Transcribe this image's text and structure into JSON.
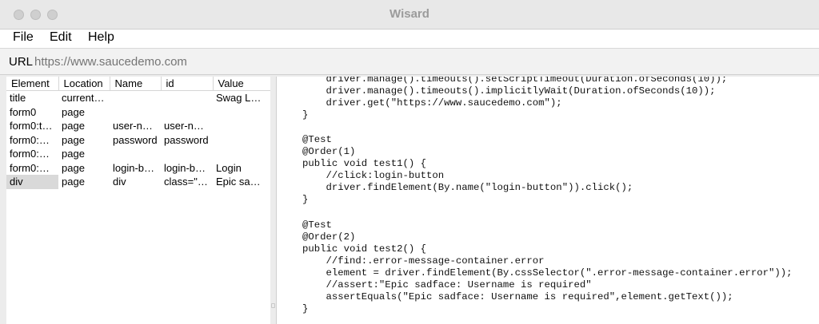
{
  "window": {
    "title": "Wisard"
  },
  "menu": [
    "File",
    "Edit",
    "Help"
  ],
  "url": {
    "label": "URL",
    "value": "",
    "placeholder": "https://www.saucedemo.com"
  },
  "elements_table": {
    "columns": [
      "Element",
      "Location",
      "Name",
      "id",
      "Value"
    ],
    "rows": [
      [
        "title",
        "current…",
        "",
        "",
        "Swag L…"
      ],
      [
        "form0",
        "page",
        "",
        "",
        ""
      ],
      [
        "form0:t…",
        "page",
        "user-n…",
        "user-n…",
        ""
      ],
      [
        "form0:…",
        "page",
        "password",
        "password",
        ""
      ],
      [
        "form0:…",
        "page",
        "",
        "",
        ""
      ],
      [
        "form0:…",
        "page",
        "login-b…",
        "login-b…",
        "Login"
      ],
      [
        "div",
        "page",
        "div",
        "class=\"…",
        "Epic sa…"
      ]
    ]
  },
  "code_lines": [
    "    driver.manage().timeouts().setScriptTimeout(Duration.ofSeconds(10));",
    "    driver.manage().timeouts().implicitlyWait(Duration.ofSeconds(10));",
    "    driver.get(\"https://www.saucedemo.com\");",
    "}",
    "",
    "@Test",
    "@Order(1)",
    "public void test1() {",
    "    //click:login-button",
    "    driver.findElement(By.name(\"login-button\")).click();",
    "}",
    "",
    "@Test",
    "@Order(2)",
    "public void test2() {",
    "    //find:.error-message-container.error",
    "    element = driver.findElement(By.cssSelector(\".error-message-container.error\"));",
    "    //assert:\"Epic sadface: Username is required\"",
    "    assertEquals(\"Epic sadface: Username is required\",element.getText());",
    "}"
  ]
}
